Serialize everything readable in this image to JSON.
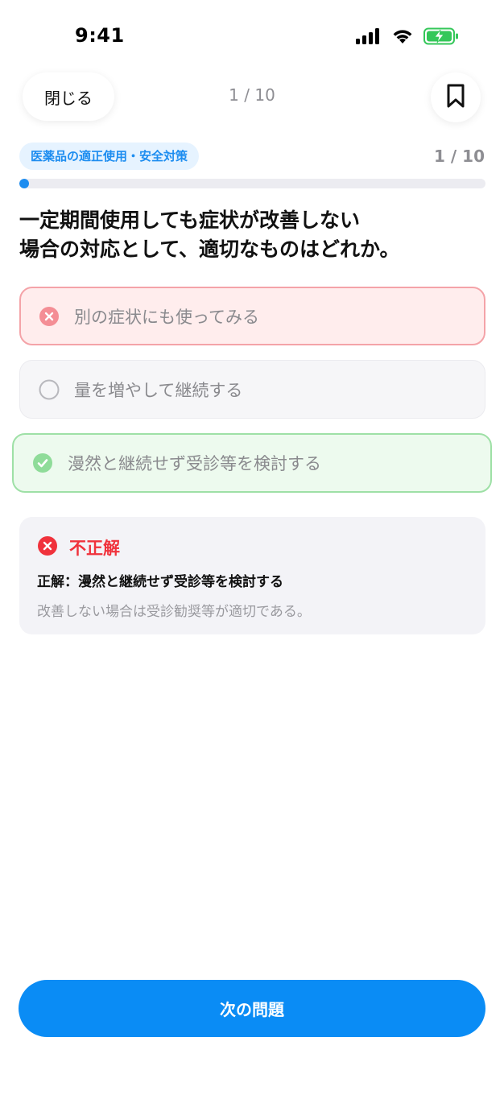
{
  "status_bar": {
    "time": "9:41"
  },
  "header": {
    "close_label": "閉じる",
    "counter": "1 / 10"
  },
  "quiz": {
    "category": "医薬品の適正使用・安全対策",
    "progress_label": "1 / 10",
    "progress": 0.1,
    "question_lines": [
      "一定期間使用しても症状が改善しない",
      "場合の対応として、適切なものはどれか。"
    ],
    "options": [
      {
        "label": "別の症状にも使ってみる",
        "state": "wrong"
      },
      {
        "label": "量を増やして継続する",
        "state": "unselected"
      },
      {
        "label": "漫然と継続せず受診等を検討する",
        "state": "correct"
      }
    ]
  },
  "feedback": {
    "status": "不正解",
    "answer": "正解：漫然と継続せず受診等を検討する",
    "explanation": "改善しない場合は受診勧奨等が適切である。"
  },
  "footer": {
    "next_label": "次の問題"
  },
  "colors": {
    "accent": "#0a8cf5",
    "error": "#f0323c",
    "success": "#5ccf6f",
    "battery": "#34c759"
  },
  "icons": {
    "signal": "cellular-signal-icon",
    "wifi": "wifi-icon",
    "battery": "battery-charging-icon",
    "bookmark": "bookmark-icon",
    "wrong": "x-circle-icon",
    "neutral": "empty-circle-icon",
    "correct": "check-circle-icon"
  }
}
